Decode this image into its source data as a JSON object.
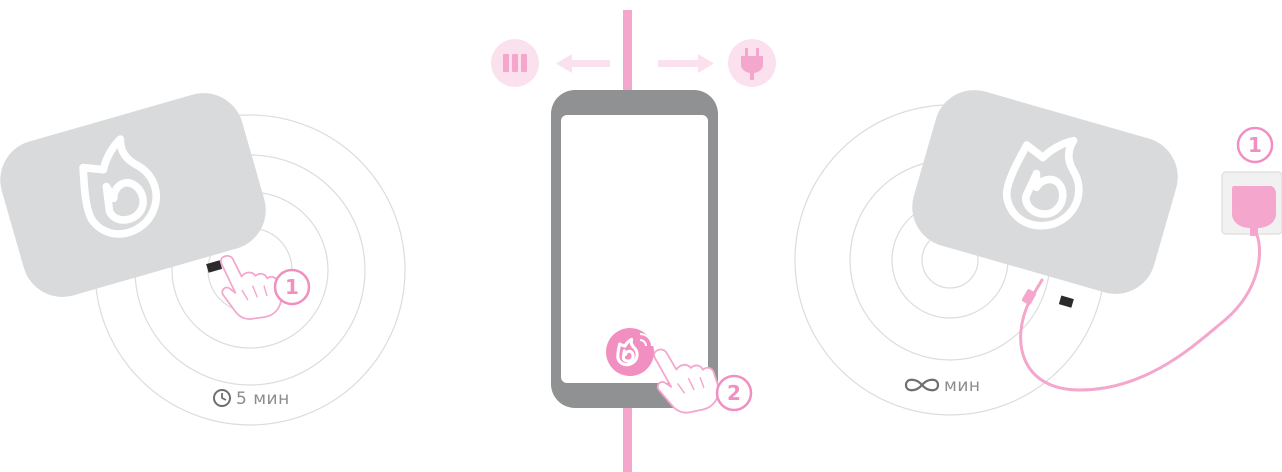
{
  "left_panel": {
    "step_badge": "1",
    "duration_label": "5 мин",
    "icons": [
      "device-icon",
      "power-button-icon",
      "finger-press-icon",
      "clock-icon"
    ]
  },
  "middle_panel": {
    "step_badge": "2",
    "icons": [
      "battery-mode-icon",
      "plug-mode-icon",
      "arrow-left-icon",
      "arrow-right-icon",
      "phone-icon",
      "app-button-icon",
      "finger-tap-icon"
    ]
  },
  "right_panel": {
    "step_badge": "1",
    "duration_label": "мин",
    "icons": [
      "infinity-icon",
      "device-icon",
      "wall-socket-icon",
      "charger-plug-icon",
      "cable-icon"
    ]
  },
  "colors": {
    "pink": "#f4a6cc",
    "pink_light": "#fbe1ee",
    "pink_badge": "#f08fc0",
    "device_gray": "#d9dadb",
    "phone_gray": "#8f9192",
    "ring_gray": "#d8d8d8",
    "text_gray": "#8c8c8c"
  }
}
